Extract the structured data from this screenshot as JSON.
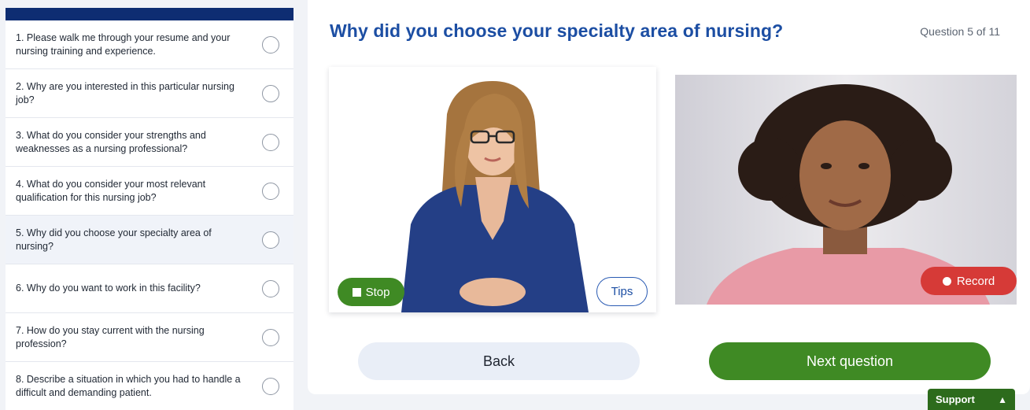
{
  "sidebar": {
    "questions": [
      {
        "label": "1. Please walk me through your resume and your nursing training and experience.",
        "active": false
      },
      {
        "label": "2. Why are you interested in this particular nursing job?",
        "active": false
      },
      {
        "label": "3. What do you consider your strengths and weaknesses as a nursing professional?",
        "active": false
      },
      {
        "label": "4. What do you consider your most relevant qualification for this nursing job?",
        "active": false
      },
      {
        "label": "5. Why did you choose your specialty area of nursing?",
        "active": true
      },
      {
        "label": "6. Why do you want to work in this facility?",
        "active": false
      },
      {
        "label": "7. How do you stay current with the nursing profession?",
        "active": false
      },
      {
        "label": "8. Describe a situation in which you had to handle a difficult and demanding patient.",
        "active": false
      }
    ]
  },
  "main": {
    "title": "Why did you choose your specialty area of nursing?",
    "counter": "Question 5 of 11",
    "interviewer": {
      "stop_label": "Stop",
      "tips_label": "Tips"
    },
    "camera": {
      "record_label": "Record"
    },
    "back_label": "Back",
    "next_label": "Next question"
  },
  "support": {
    "label": "Support"
  },
  "colors": {
    "sidebar_header": "#0e2d72",
    "title": "#1c4ea3",
    "green": "#3f8a24",
    "record_red": "#d63a37"
  }
}
